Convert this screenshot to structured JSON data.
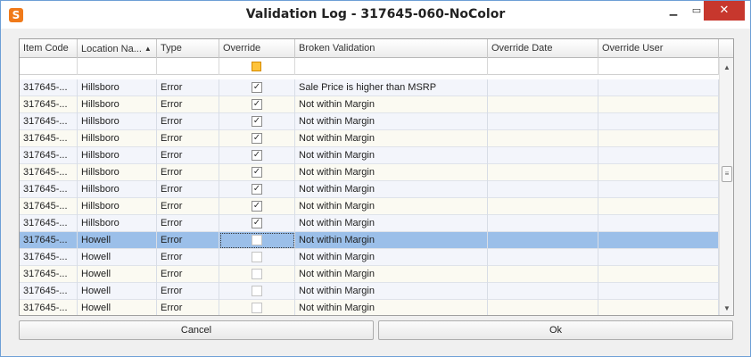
{
  "window": {
    "title": "Validation Log - 317645-060-NoColor",
    "icons": {
      "app": "app-logo-icon",
      "minimize": "minimize-icon",
      "maximize": "maximize-icon",
      "close": "close-icon"
    },
    "controls": {
      "minimize": "▁",
      "maximize": "▭",
      "close": "✕"
    },
    "app_glyph": "S",
    "colors": {
      "accent": "#9bbfe9",
      "close_button": "#c7372d",
      "filter_check": "#ffc33a"
    }
  },
  "grid": {
    "columns": [
      "Item Code",
      "Location Na...",
      "Type",
      "Override",
      "Broken Validation",
      "Override Date",
      "Override User"
    ],
    "sort_indicator": "▲",
    "rows": [
      {
        "item_code": "317645-...",
        "location": "Hillsboro",
        "type": "Error",
        "override": true,
        "broken_validation": "Sale Price is higher than MSRP",
        "override_date": "",
        "override_user": ""
      },
      {
        "item_code": "317645-...",
        "location": "Hillsboro",
        "type": "Error",
        "override": true,
        "broken_validation": "Not within Margin",
        "override_date": "",
        "override_user": ""
      },
      {
        "item_code": "317645-...",
        "location": "Hillsboro",
        "type": "Error",
        "override": true,
        "broken_validation": "Not within Margin",
        "override_date": "",
        "override_user": ""
      },
      {
        "item_code": "317645-...",
        "location": "Hillsboro",
        "type": "Error",
        "override": true,
        "broken_validation": "Not within Margin",
        "override_date": "",
        "override_user": ""
      },
      {
        "item_code": "317645-...",
        "location": "Hillsboro",
        "type": "Error",
        "override": true,
        "broken_validation": "Not within Margin",
        "override_date": "",
        "override_user": ""
      },
      {
        "item_code": "317645-...",
        "location": "Hillsboro",
        "type": "Error",
        "override": true,
        "broken_validation": "Not within Margin",
        "override_date": "",
        "override_user": ""
      },
      {
        "item_code": "317645-...",
        "location": "Hillsboro",
        "type": "Error",
        "override": true,
        "broken_validation": "Not within Margin",
        "override_date": "",
        "override_user": ""
      },
      {
        "item_code": "317645-...",
        "location": "Hillsboro",
        "type": "Error",
        "override": true,
        "broken_validation": "Not within Margin",
        "override_date": "",
        "override_user": ""
      },
      {
        "item_code": "317645-...",
        "location": "Hillsboro",
        "type": "Error",
        "override": true,
        "broken_validation": "Not within Margin",
        "override_date": "",
        "override_user": ""
      },
      {
        "item_code": "317645-...",
        "location": "Howell",
        "type": "Error",
        "override": false,
        "broken_validation": "Not within Margin",
        "override_date": "",
        "override_user": "",
        "selected": true
      },
      {
        "item_code": "317645-...",
        "location": "Howell",
        "type": "Error",
        "override": false,
        "broken_validation": "Not within Margin",
        "override_date": "",
        "override_user": ""
      },
      {
        "item_code": "317645-...",
        "location": "Howell",
        "type": "Error",
        "override": false,
        "broken_validation": "Not within Margin",
        "override_date": "",
        "override_user": ""
      },
      {
        "item_code": "317645-...",
        "location": "Howell",
        "type": "Error",
        "override": false,
        "broken_validation": "Not within Margin",
        "override_date": "",
        "override_user": ""
      },
      {
        "item_code": "317645-...",
        "location": "Howell",
        "type": "Error",
        "override": false,
        "broken_validation": "Not within Margin",
        "override_date": "",
        "override_user": ""
      }
    ],
    "scrollbar": {
      "up": "▲",
      "down": "▼",
      "thumb": "≡"
    }
  },
  "footer": {
    "cancel_label": "Cancel",
    "ok_label": "Ok"
  }
}
